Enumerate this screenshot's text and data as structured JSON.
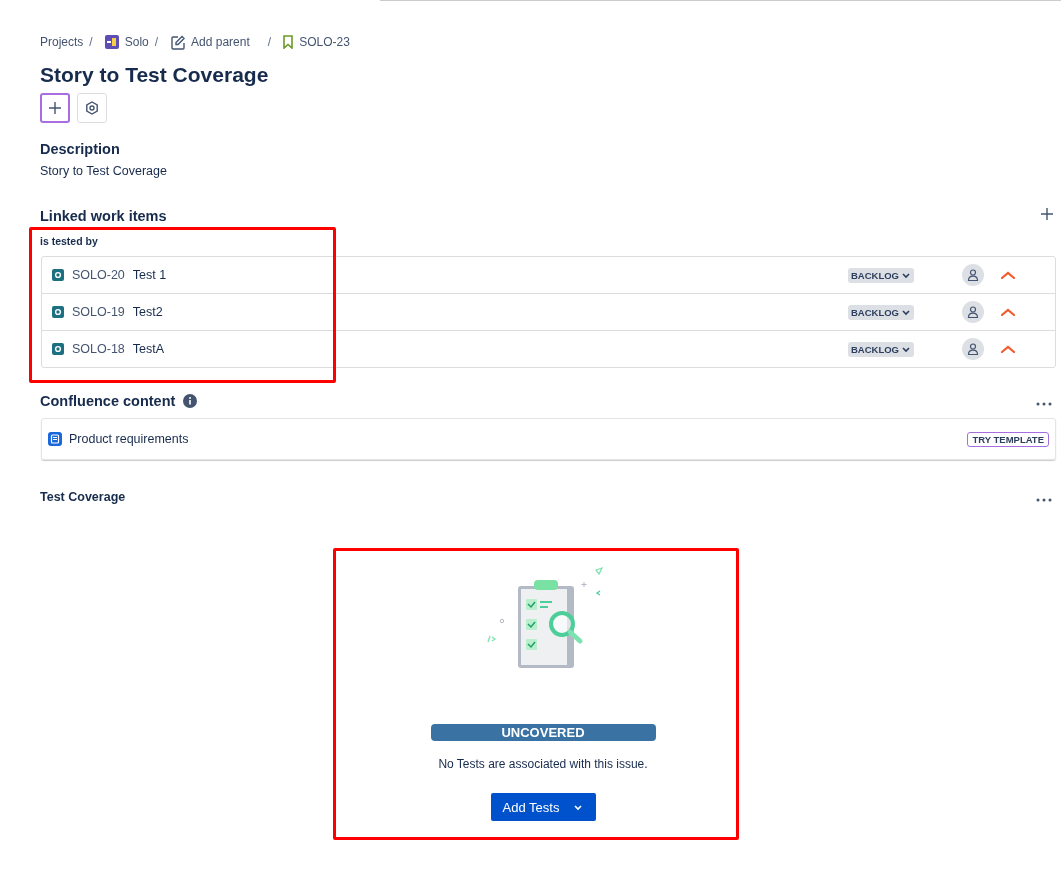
{
  "breadcrumb": [
    {
      "kind": "text",
      "label": "Projects"
    },
    {
      "kind": "project",
      "separator": "/",
      "label": "Solo"
    },
    {
      "kind": "parent",
      "separator": "/",
      "label": "Add parent"
    },
    {
      "kind": "story",
      "separator": "/",
      "label": "SOLO-23"
    }
  ],
  "title": "Story to Test Coverage",
  "description": {
    "heading": "Description",
    "text": "Story to Test Coverage"
  },
  "linked": {
    "heading": "Linked work items",
    "relation": "is tested by",
    "items": [
      {
        "key": "SOLO-20",
        "summary": "Test 1",
        "status": "BACKLOG"
      },
      {
        "key": "SOLO-19",
        "summary": "Test2",
        "status": "BACKLOG"
      },
      {
        "key": "SOLO-18",
        "summary": "TestA",
        "status": "BACKLOG"
      }
    ]
  },
  "confluence": {
    "heading": "Confluence content",
    "items": [
      {
        "title": "Product requirements",
        "badge": "TRY TEMPLATE"
      }
    ]
  },
  "test_coverage": {
    "heading": "Test Coverage",
    "status": "UNCOVERED",
    "message": "No Tests are associated with this issue.",
    "button": "Add Tests"
  }
}
